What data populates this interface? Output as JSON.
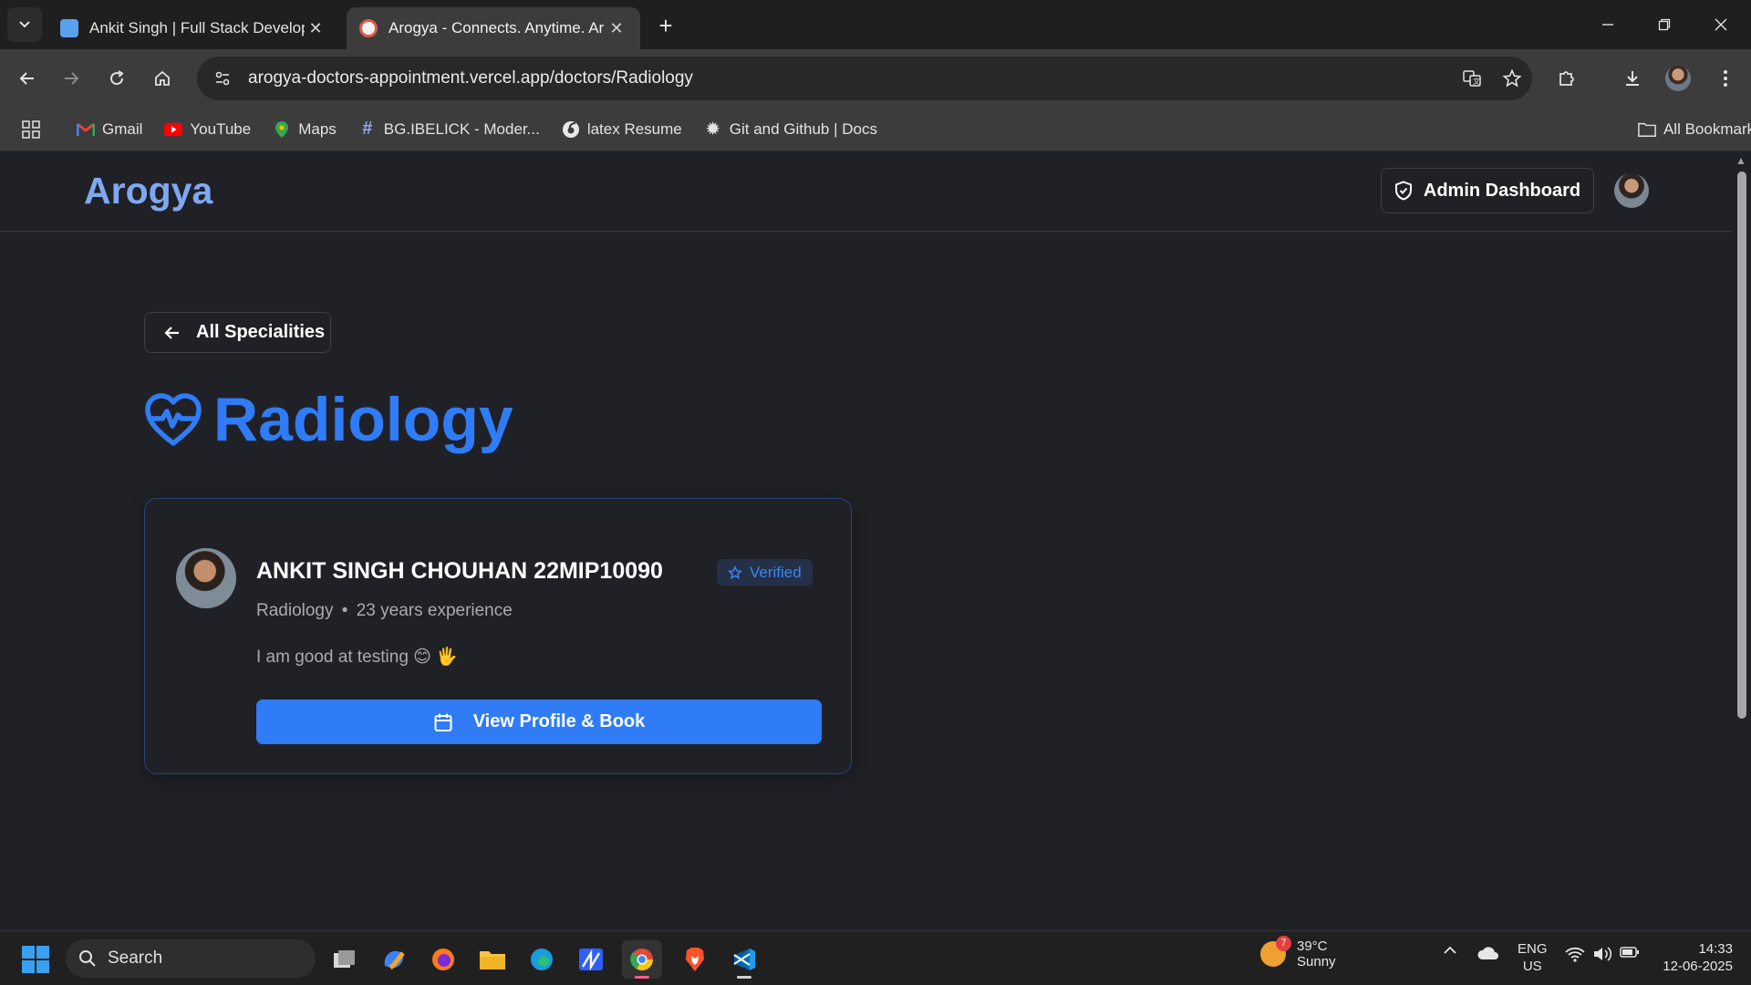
{
  "browser": {
    "tabs": [
      {
        "title": "Ankit Singh | Full Stack Develop",
        "close": "✕",
        "active": false
      },
      {
        "title": "Arogya - Connects. Anytime. Ar",
        "close": "✕",
        "active": true
      }
    ],
    "new_tab": "+",
    "url": "arogya-doctors-appointment.vercel.app/doctors/Radiology",
    "bookmarks": [
      {
        "label": "Gmail",
        "icon": "gmail-icon"
      },
      {
        "label": "YouTube",
        "icon": "youtube-icon"
      },
      {
        "label": "Maps",
        "icon": "maps-icon"
      },
      {
        "label": "BG.IBELICK - Moder...",
        "icon": "hash-icon"
      },
      {
        "label": "latex Resume",
        "icon": "overleaf-icon"
      },
      {
        "label": "Git and Github | Docs",
        "icon": "gear-icon"
      }
    ],
    "all_bookmarks": "All Bookmarks"
  },
  "site": {
    "brand": "Arogya",
    "admin_button": "Admin Dashboard",
    "back_button": "All Specialities",
    "page_title": "Radiology",
    "doctor": {
      "name": "ANKIT SINGH CHOUHAN 22MIP10090",
      "verified": "Verified",
      "specialty": "Radiology",
      "separator": "•",
      "experience": "23 years experience",
      "bio": "I am good at testing 😊 🖐",
      "book_button": "View Profile & Book"
    }
  },
  "taskbar": {
    "search": "Search",
    "weather": {
      "temp": "39°C",
      "condition": "Sunny",
      "badge": "7"
    },
    "lang": {
      "line1": "ENG",
      "line2": "US"
    },
    "clock": {
      "time": "14:33",
      "date": "12-06-2025"
    }
  },
  "colors": {
    "accent": "#2f7cf6",
    "brand": "#7fa8f2",
    "page_bg": "#202127",
    "verified_bg": "#243047"
  }
}
